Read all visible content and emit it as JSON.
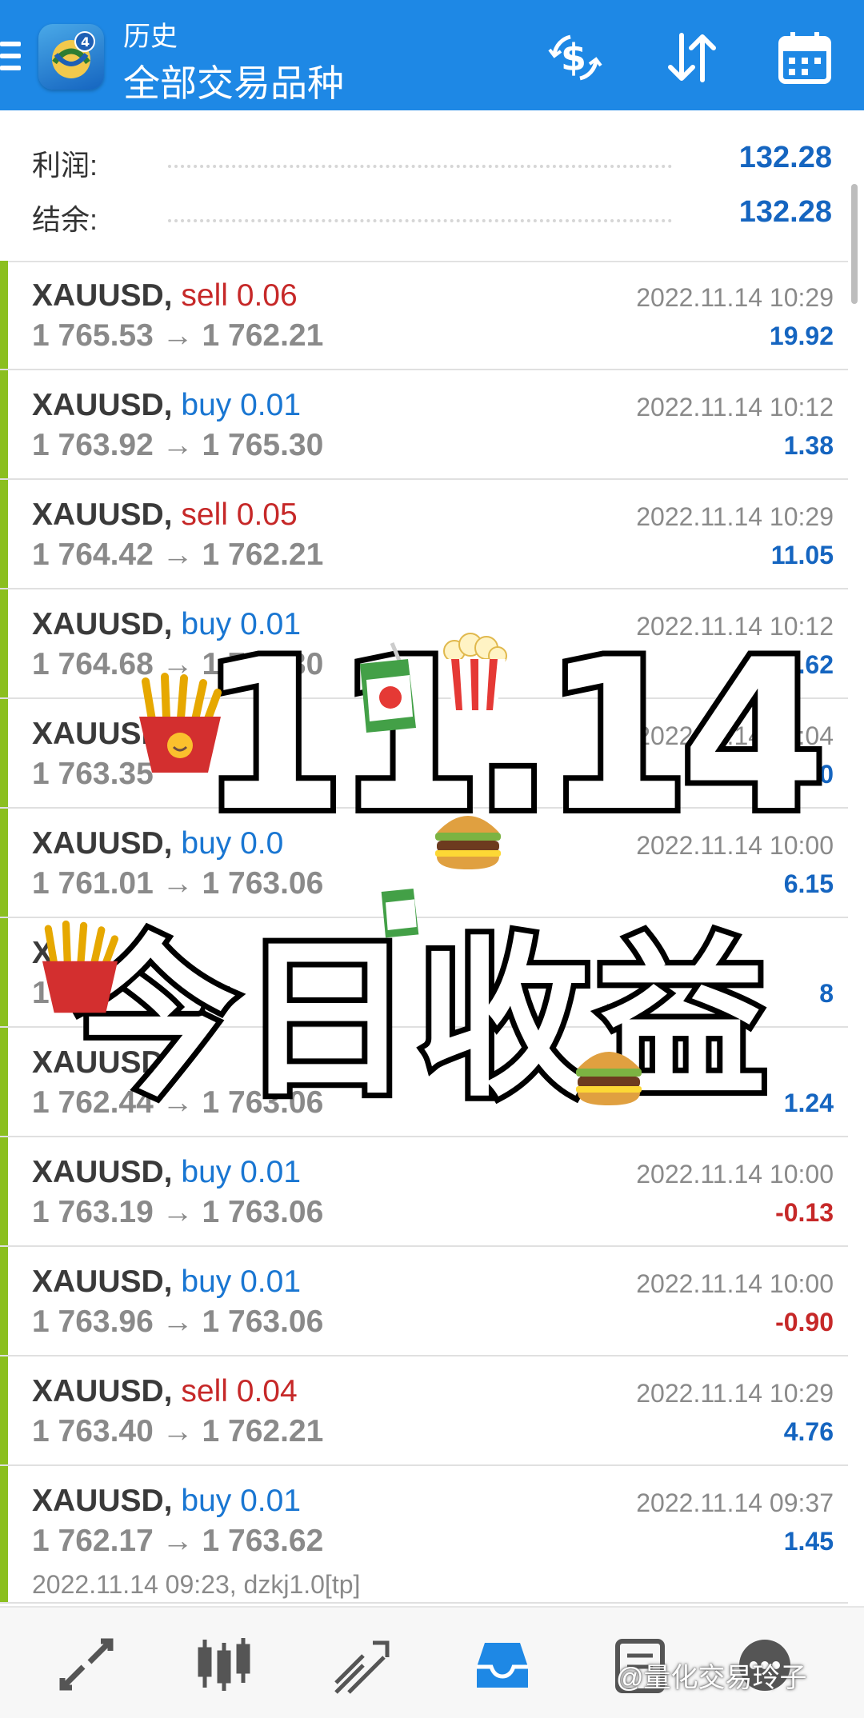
{
  "header": {
    "subtitle": "历史",
    "title": "全部交易品种",
    "icons": [
      "menu-icon",
      "app-logo",
      "currency-icon",
      "sort-icon",
      "calendar-icon"
    ]
  },
  "summary": {
    "profit_label": "利润:",
    "profit_value": "132.28",
    "balance_label": "结余:",
    "balance_value": "132.28"
  },
  "trades": [
    {
      "symbol": "XAUUSD,",
      "type": "sell",
      "volume": "0.06",
      "open": "1 765.53",
      "close": "1 762.21",
      "time": "2022.11.14 10:29",
      "profit": "19.92"
    },
    {
      "symbol": "XAUUSD,",
      "type": "buy",
      "volume": "0.01",
      "open": "1 763.92",
      "close": "1 765.30",
      "time": "2022.11.14 10:12",
      "profit": "1.38"
    },
    {
      "symbol": "XAUUSD,",
      "type": "sell",
      "volume": "0.05",
      "open": "1 764.42",
      "close": "1 762.21",
      "time": "2022.11.14 10:29",
      "profit": "11.05"
    },
    {
      "symbol": "XAUUSD,",
      "type": "buy",
      "volume": "0.01",
      "open": "1 764.68",
      "close": "1 765.30",
      "time": "2022.11.14 10:12",
      "profit": "0.62"
    },
    {
      "symbol": "XAUUSD",
      "type": "",
      "volume": "",
      "open": "1 763.35",
      "close": "",
      "time": "2022.11.14 10:04",
      "profit": "1.00"
    },
    {
      "symbol": "XAUUSD,",
      "type": "buy",
      "volume": "0.0",
      "open": "1 761.01",
      "close": "1 763.06",
      "time": "2022.11.14 10:00",
      "profit": "6.15"
    },
    {
      "symbol": "X",
      "type": "",
      "volume": "",
      "open": "1",
      "close": "",
      "time": "",
      "profit": "8"
    },
    {
      "symbol": "XAUUSD,",
      "type": "",
      "volume": "",
      "open": "1 762.44",
      "close": "1 763.06",
      "time": "",
      "profit": "1.24"
    },
    {
      "symbol": "XAUUSD,",
      "type": "buy",
      "volume": "0.01",
      "open": "1 763.19",
      "close": "1 763.06",
      "time": "2022.11.14 10:00",
      "profit": "-0.13"
    },
    {
      "symbol": "XAUUSD,",
      "type": "buy",
      "volume": "0.01",
      "open": "1 763.96",
      "close": "1 763.06",
      "time": "2022.11.14 10:00",
      "profit": "-0.90"
    },
    {
      "symbol": "XAUUSD,",
      "type": "sell",
      "volume": "0.04",
      "open": "1 763.40",
      "close": "1 762.21",
      "time": "2022.11.14 10:29",
      "profit": "4.76"
    },
    {
      "symbol": "XAUUSD,",
      "type": "buy",
      "volume": "0.01",
      "open": "1 762.17",
      "close": "1 763.62",
      "time": "2022.11.14 09:37",
      "profit": "1.45",
      "comment": "2022.11.14 09:23, dzkj1.0[tp]"
    }
  ],
  "arrow": "→",
  "overlay": {
    "date_text": "11.14",
    "title_text": "今日收益",
    "stickers": [
      "fries-icon",
      "juice-box-icon",
      "popcorn-icon",
      "burger-icon"
    ]
  },
  "bottom_nav": {
    "icons": [
      "quotes-icon",
      "chart-icon",
      "trade-icon",
      "history-icon",
      "news-icon",
      "messages-icon"
    ],
    "active": "history-icon"
  },
  "watermark": "@量化交易玲子",
  "colors": {
    "header_bg": "#1e88e5",
    "accent": "#1565c0",
    "sell": "#c62828",
    "buy": "#1976d2",
    "row_marker": "#8bbf1f"
  }
}
